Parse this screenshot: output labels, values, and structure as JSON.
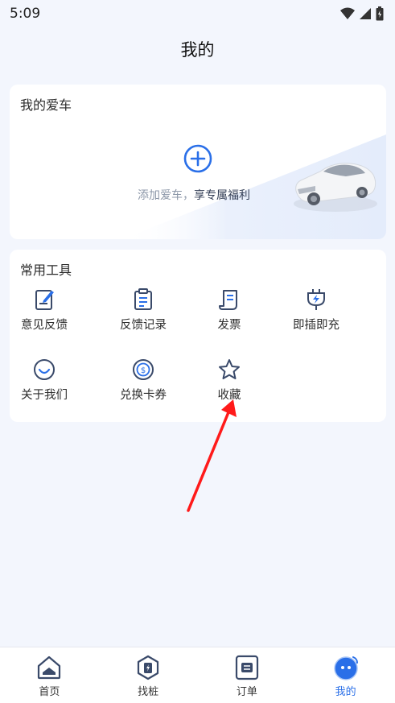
{
  "status_bar": {
    "time": "5:09"
  },
  "page": {
    "title": "我的"
  },
  "my_car": {
    "title": "我的爱车",
    "add_prefix": "添加爱车，",
    "add_highlight": "享专属福利"
  },
  "tools": {
    "title": "常用工具",
    "items": [
      {
        "label": "意见反馈",
        "icon": "feedback-icon"
      },
      {
        "label": "反馈记录",
        "icon": "record-icon"
      },
      {
        "label": "发票",
        "icon": "invoice-icon"
      },
      {
        "label": "即插即充",
        "icon": "plug-charge-icon"
      },
      {
        "label": "关于我们",
        "icon": "about-icon"
      },
      {
        "label": "兑换卡券",
        "icon": "coupon-icon"
      },
      {
        "label": "收藏",
        "icon": "star-icon"
      }
    ]
  },
  "tabbar": {
    "items": [
      {
        "label": "首页",
        "icon": "home-icon"
      },
      {
        "label": "找桩",
        "icon": "charger-icon"
      },
      {
        "label": "订单",
        "icon": "order-icon"
      },
      {
        "label": "我的",
        "icon": "profile-icon"
      }
    ],
    "active_index": 3
  },
  "colors": {
    "accent": "#2a6fe8",
    "icon": "#3a4a6a",
    "arrow": "#ff1a1a"
  }
}
